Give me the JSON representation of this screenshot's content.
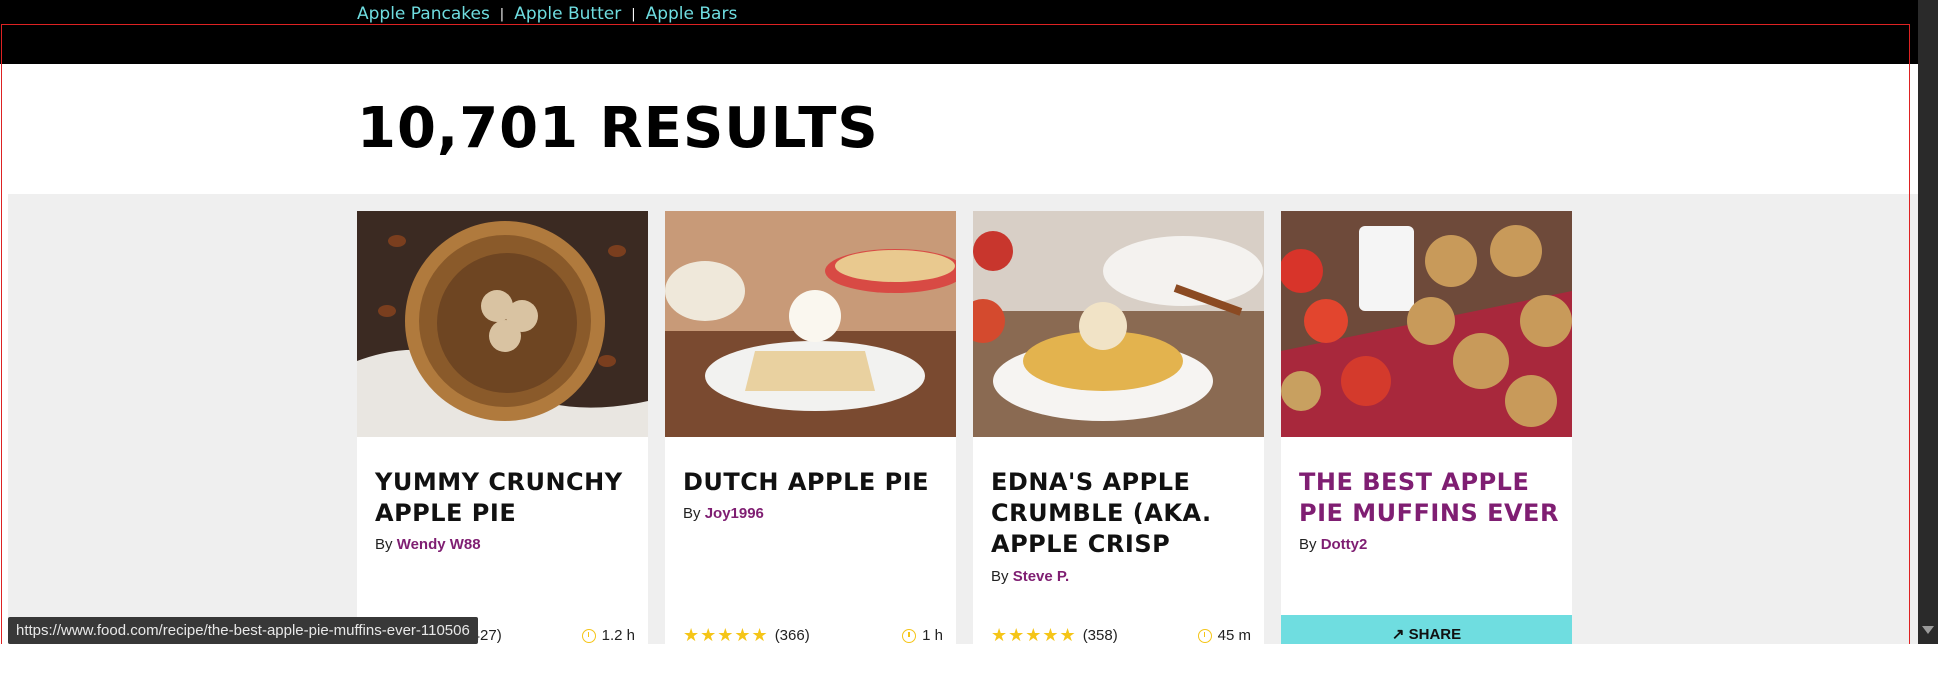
{
  "related_links": [
    "Apple Pancakes",
    "Apple Butter",
    "Apple Bars"
  ],
  "related_separator": "|",
  "results_heading": "10,701 RESULTS",
  "cards": [
    {
      "title": "YUMMY CRUNCHY APPLE PIE",
      "by": "By",
      "author": "Wendy W88",
      "stars": "★★★★★",
      "count": "(427)",
      "time": "1.2 h"
    },
    {
      "title": "DUTCH APPLE PIE",
      "by": "By",
      "author": "Joy1996",
      "stars": "★★★★★",
      "count": "(366)",
      "time": "1 h"
    },
    {
      "title": "EDNA'S APPLE CRUMBLE (AKA. APPLE CRISP",
      "by": "By",
      "author": "Steve P.",
      "stars": "★★★★★",
      "count": "(358)",
      "time": "45 m"
    },
    {
      "title": "THE BEST APPLE PIE MUFFINS EVER",
      "by": "By",
      "author": "Dotty2",
      "share": "↗ SHARE"
    }
  ],
  "status_url": "https://www.food.com/recipe/the-best-apple-pie-muffins-ever-110506",
  "colors": {
    "accent_teal": "#6fdde0",
    "author_purple": "#7f1e72",
    "star_yellow": "#f5c518"
  }
}
